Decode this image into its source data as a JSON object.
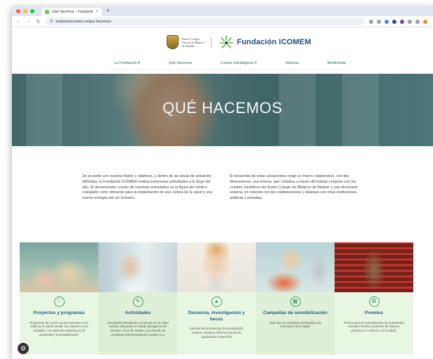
{
  "browser": {
    "tab_title": "Qué hacemos – Fundación ICOMEM",
    "tab_close": "×",
    "new_tab": "+",
    "url": "fundacionicomem.es/que-hacemos/",
    "traffic_lights": [
      "#ff5f57",
      "#febc2e",
      "#28c840"
    ],
    "extension_colors": [
      "#9aa0a6",
      "#9aa0a6",
      "#4285f4",
      "#3b4b9a",
      "#7b3fa0",
      "#9aa0a6",
      "#9aa0a6",
      "#f28b30"
    ]
  },
  "header": {
    "college_name": "Ilustre Colegio Oficial de Médicos de Madrid",
    "foundation_name": "Fundación ICOMEM",
    "nav": [
      {
        "label": "La Fundación ▾"
      },
      {
        "label": "Qué hacemos"
      },
      {
        "label": "Líneas estratégicas ▾"
      },
      {
        "label": "Noticias"
      },
      {
        "label": "Multimedia"
      }
    ]
  },
  "hero": {
    "title": "QUÉ HACEMOS"
  },
  "intro": {
    "left": "De acuerdo con nuestra misión y objetivos, y dentro de las áreas de actuación definidas, la Fundación ICOMEM realiza numerosas actividades a lo largo del año. El denominador común de nuestras actividades es la figura del médico colegiado como referente para la implantación de una cultura de la salud y una nueva ecología del ser humano.",
    "right": "El desarrollo de estas actuaciones exige un marco colaborativo, con dos dimensiones: una interna, que cristaliza a través del trabajo conjunto con los comités científicos del Ilustre Colegio de Médicos de Madrid; y una dimensión externa, en relación con las colaboraciones y alianzas con otras instituciones públicas y privadas."
  },
  "cards": [
    {
      "icon": "♡",
      "title": "Proyectos y programas",
      "desc": "Programas de acción social centrados en la infancia, la salud mental, los mayores y los cuidados, con especial incidencia en el desarrollo y la sensibilización"
    },
    {
      "icon": "✎",
      "title": "Actividades",
      "desc": "Actividades destinadas al fomento de la salud mental, educación en salud, divulgación de estudios, foros de debate y promoción de iniciativas transformadoras acordes con"
    },
    {
      "icon": "▲",
      "title": "Docencia, investigación y becas",
      "desc": "Impulso de la docencia, la investigación médica, ensayos clínicos y becas de capacitación específica"
    },
    {
      "icon": "▦",
      "title": "Campañas de sensibilización",
      "desc": "Todo tipo de iniciativas destinadas a la promoción de la salud"
    },
    {
      "icon": "✪",
      "title": "Premios",
      "desc": "Premio para la Humanización de la Medicina Vicente Pozuelo y premios de mejores prácticas en relación con la salud."
    }
  ],
  "cookie_icon": "⚙",
  "accent_color": "#43a36a"
}
